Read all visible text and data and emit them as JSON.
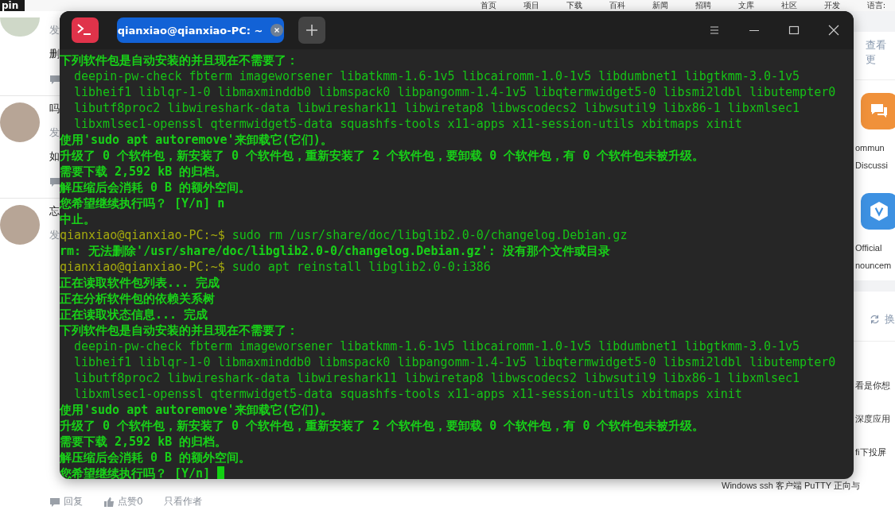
{
  "site_header": {
    "logo": "pin",
    "nav": [
      "首页",
      "项目",
      "下载",
      "百科",
      "新闻",
      "招聘",
      "文库",
      "社区",
      "开发",
      "语言:"
    ]
  },
  "posts": [
    {
      "lines": [
        {
          "kind": "meta",
          "text": "发"
        },
        {
          "kind": "title",
          "text": "删"
        },
        {
          "kind": "comment"
        }
      ]
    },
    {
      "lines": [
        {
          "kind": "title",
          "text": "吗"
        },
        {
          "kind": "meta",
          "text": "发"
        },
        {
          "kind": "title",
          "text": "如"
        },
        {
          "kind": "comment"
        }
      ]
    },
    {
      "lines": [
        {
          "kind": "title",
          "text": "忘"
        },
        {
          "kind": "meta",
          "text": "发"
        }
      ]
    }
  ],
  "post_actions": [
    "回复",
    "点赞0",
    "只看作者"
  ],
  "sidebar": {
    "more_link": "查看更",
    "categories": [
      {
        "color": "#f0913a",
        "label_lines": [
          "ommun",
          "Discussi"
        ]
      },
      {
        "color": "#3d91e2",
        "label_lines": [
          "Official",
          "nouncem"
        ]
      }
    ],
    "refresh_label": "换",
    "topics": [
      "看是你想",
      "深度应用",
      "fi下投屏",
      "Windows ssh 客户端 PuTTY 正向与"
    ]
  },
  "terminal": {
    "tabs": [
      {
        "label": "qianxiao@qianxiao-PC: ~",
        "selected": true
      }
    ],
    "lines": [
      {
        "kind": "output",
        "text": "下列软件包是自动安装的并且现在不需要了："
      },
      {
        "kind": "indent",
        "text": "deepin-pw-check fbterm imageworsener libatkmm-1.6-1v5 libcairomm-1.0-1v5 libdumbnet1 libgtkmm-3.0-1v5"
      },
      {
        "kind": "indent",
        "text": "libheif1 liblqr-1-0 libmaxminddb0 libmspack0 libpangomm-1.4-1v5 libqtermwidget5-0 libsmi2ldbl libutempter0"
      },
      {
        "kind": "indent",
        "text": "libutf8proc2 libwireshark-data libwireshark11 libwiretap8 libwscodecs2 libwsutil9 libx86-1 libxmlsec1"
      },
      {
        "kind": "indent",
        "text": "libxmlsec1-openssl qtermwidget5-data squashfs-tools x11-apps x11-session-utils xbitmaps xinit"
      },
      {
        "kind": "output",
        "text": "使用'sudo apt autoremove'来卸载它(它们)。"
      },
      {
        "kind": "output",
        "text": "升级了 0 个软件包，新安装了 0 个软件包，重新安装了 2 个软件包，要卸载 0 个软件包，有 0 个软件包未被升级。"
      },
      {
        "kind": "output",
        "text": "需要下载 2,592 kB 的归档。"
      },
      {
        "kind": "output",
        "text": "解压缩后会消耗 0 B 的额外空间。"
      },
      {
        "kind": "output",
        "text": "您希望继续执行吗？ [Y/n] n"
      },
      {
        "kind": "output",
        "text": "中止。"
      },
      {
        "kind": "prompt",
        "prompt": "qianxiao@qianxiao-PC:~$",
        "text": "sudo rm /usr/share/doc/libglib2.0-0/changelog.Debian.gz"
      },
      {
        "kind": "output",
        "text": "rm: 无法删除'/usr/share/doc/libglib2.0-0/changelog.Debian.gz': 没有那个文件或目录"
      },
      {
        "kind": "prompt",
        "prompt": "qianxiao@qianxiao-PC:~$",
        "text": "sudo apt reinstall libglib2.0-0:i386"
      },
      {
        "kind": "output",
        "text": "正在读取软件包列表... 完成"
      },
      {
        "kind": "output",
        "text": "正在分析软件包的依赖关系树"
      },
      {
        "kind": "output",
        "text": "正在读取状态信息... 完成"
      },
      {
        "kind": "output",
        "text": "下列软件包是自动安装的并且现在不需要了："
      },
      {
        "kind": "indent",
        "text": "deepin-pw-check fbterm imageworsener libatkmm-1.6-1v5 libcairomm-1.0-1v5 libdumbnet1 libgtkmm-3.0-1v5"
      },
      {
        "kind": "indent",
        "text": "libheif1 liblqr-1-0 libmaxminddb0 libmspack0 libpangomm-1.4-1v5 libqtermwidget5-0 libsmi2ldbl libutempter0"
      },
      {
        "kind": "indent",
        "text": "libutf8proc2 libwireshark-data libwireshark11 libwiretap8 libwscodecs2 libwsutil9 libx86-1 libxmlsec1"
      },
      {
        "kind": "indent",
        "text": "libxmlsec1-openssl qtermwidget5-data squashfs-tools x11-apps x11-session-utils xbitmaps xinit"
      },
      {
        "kind": "output",
        "text": "使用'sudo apt autoremove'来卸载它(它们)。"
      },
      {
        "kind": "output",
        "text": "升级了 0 个软件包，新安装了 0 个软件包，重新安装了 2 个软件包，要卸载 0 个软件包，有 0 个软件包未被升级。"
      },
      {
        "kind": "output",
        "text": "需要下载 2,592 kB 的归档。"
      },
      {
        "kind": "output",
        "text": "解压缩后会消耗 0 B 的额外空间。"
      },
      {
        "kind": "input",
        "text": "您希望继续执行吗？ [Y/n]"
      }
    ]
  }
}
